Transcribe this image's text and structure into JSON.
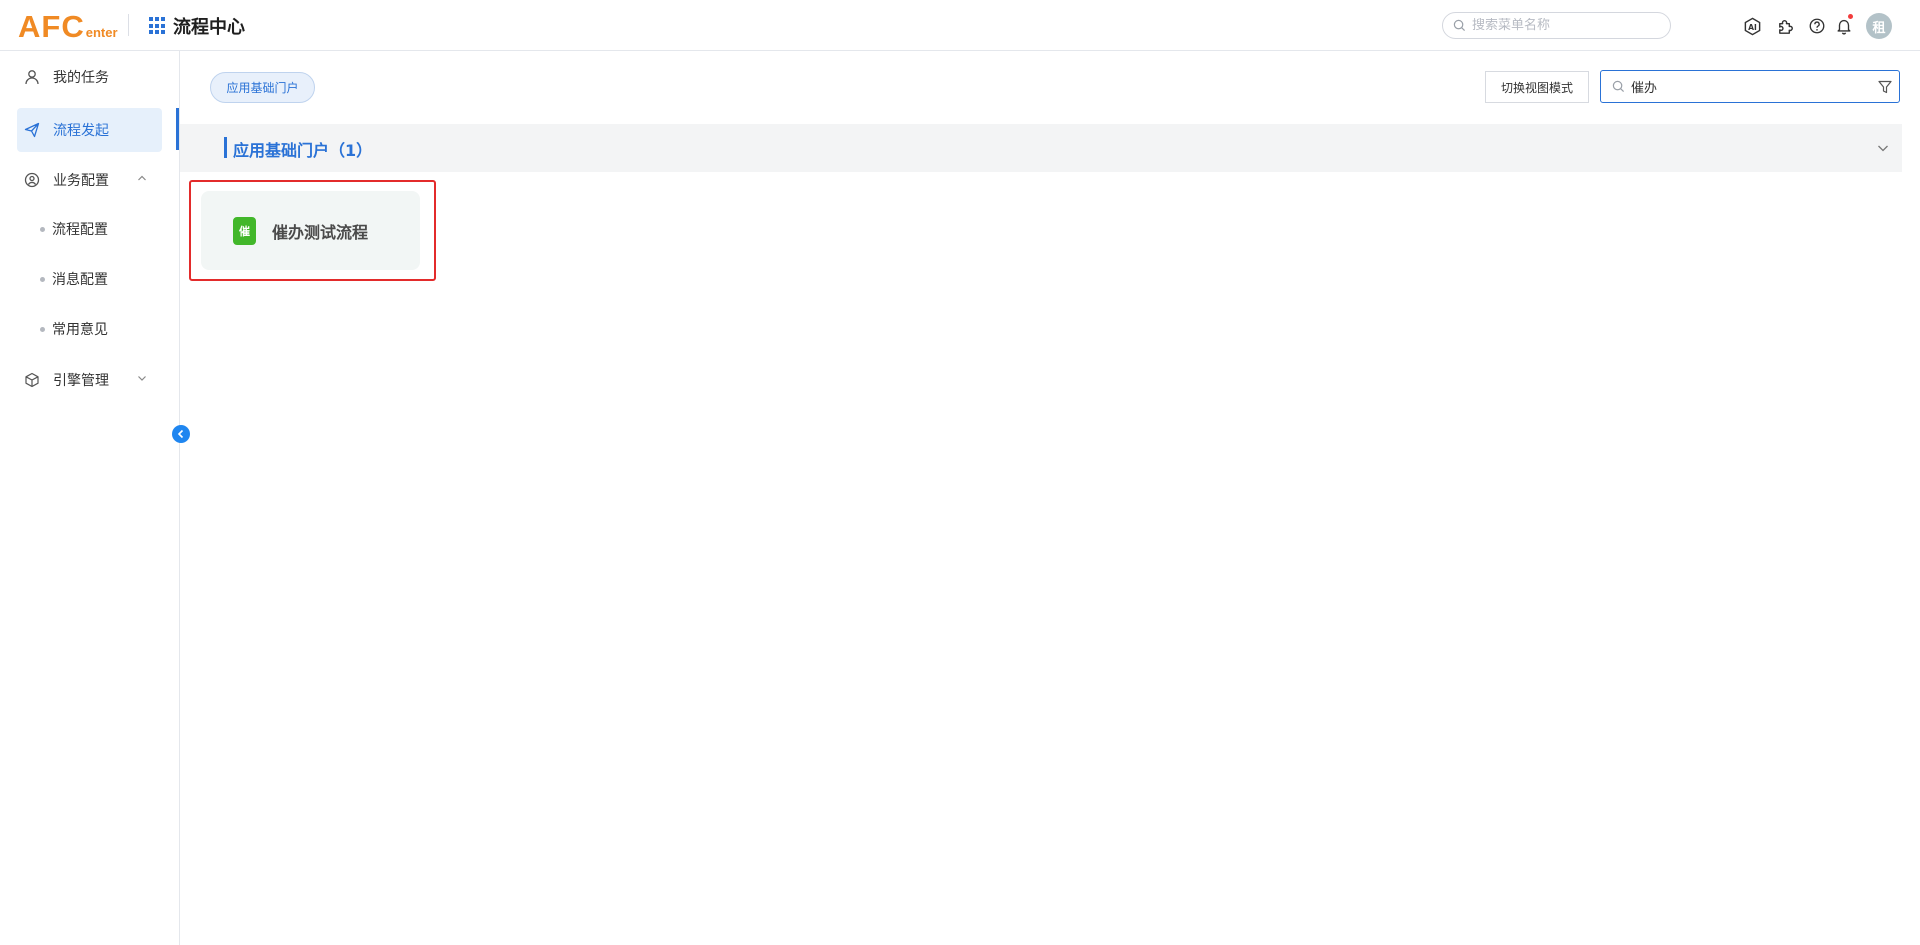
{
  "header": {
    "logo_main": "AFC",
    "logo_sub": "enter",
    "app_title": "流程中心",
    "menu_search_placeholder": "搜索菜单名称",
    "avatar_text": "租",
    "icons": [
      "ai-icon",
      "plugin-icon",
      "help-icon",
      "bell-icon"
    ]
  },
  "sidebar": {
    "items": [
      {
        "label": "我的任务",
        "icon": "user-icon"
      },
      {
        "label": "流程发起",
        "icon": "send-icon",
        "active": true
      },
      {
        "label": "业务配置",
        "icon": "settings-circle-icon",
        "expanded": true
      },
      {
        "label": "引擎管理",
        "icon": "cube-icon",
        "expanded": false
      }
    ],
    "sub_items": [
      "流程配置",
      "消息配置",
      "常用意见"
    ]
  },
  "main": {
    "portal_tag": "应用基础门户",
    "switch_view_label": "切换视图模式",
    "search_value": "催办",
    "group": {
      "title": "应用基础门户（1）",
      "processes": [
        {
          "badge": "催",
          "badge_color": "#42b72a",
          "name": "催办测试流程"
        }
      ]
    }
  },
  "colors": {
    "accent": "#2a72d6",
    "logo": "#f08a24",
    "highlight": "#e32b2b"
  }
}
